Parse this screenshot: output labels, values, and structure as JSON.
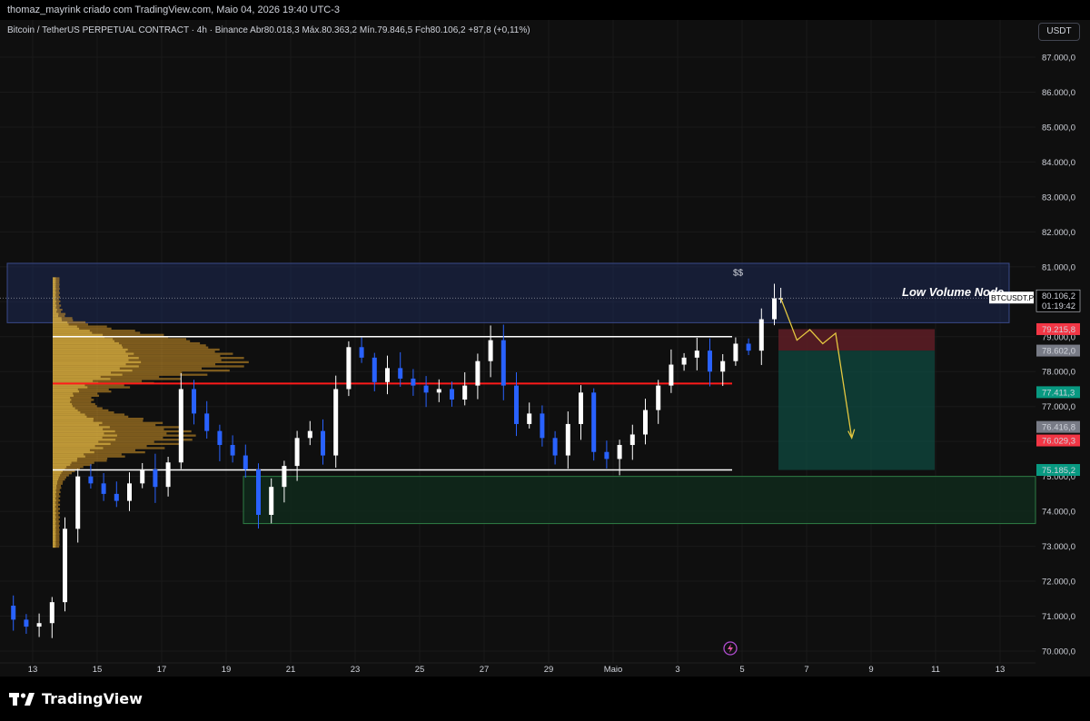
{
  "header": {
    "title": "thomaz_mayrink criado com TradingView.com, Maio 04, 2026 19:40 UTC-3"
  },
  "symbol": {
    "name": "Bitcoin / TetherUS PERPETUAL CONTRACT · 4h · Binance",
    "open_label": "Abr",
    "open_value": "80.018,3",
    "high_label": "Máx.",
    "high_value": "80.363,2",
    "low_label": "Mín.",
    "low_value": "79.846,5",
    "close_label": "Fch",
    "close_value": "80.106,2",
    "change": "+87,8 (+0,11%)"
  },
  "currency_button": "USDT",
  "annotations": {
    "low_volume_node": "Low Volume Node",
    "dollar_marks": "$$"
  },
  "price_axis": {
    "ticks": [
      "87.000,0",
      "86.000,0",
      "85.000,0",
      "84.000,0",
      "83.000,0",
      "82.000,0",
      "81.000,0",
      "80.000,0",
      "79.000,0",
      "78.000,0",
      "77.000,0",
      "76.000,0",
      "75.000,0",
      "74.000,0",
      "73.000,0",
      "72.000,0",
      "71.000,0",
      "70.000,0"
    ],
    "current_symbol": "BTCUSDT.P",
    "current_price": "80.106,2",
    "countdown": "01:19:42",
    "labels": [
      {
        "text": "79.215,8",
        "color": "#f23645"
      },
      {
        "text": "78.602,0",
        "color": "#787b86"
      },
      {
        "text": "77.411,3",
        "color": "#089981"
      },
      {
        "text": "76.416,8",
        "color": "#787b86"
      },
      {
        "text": "76.029,3",
        "color": "#f23645"
      },
      {
        "text": "75.185,2",
        "color": "#089981"
      }
    ]
  },
  "time_axis": {
    "labels": [
      "13",
      "15",
      "17",
      "19",
      "21",
      "23",
      "25",
      "27",
      "29",
      "Maio",
      "3",
      "5",
      "7",
      "9",
      "11",
      "13"
    ]
  },
  "colors": {
    "background": "#0f0f0f",
    "up_candle": "#ffffff",
    "down_candle": "#2962ff",
    "resistance_line": "#ff1a1a",
    "zone_blue": "#1e2a55",
    "zone_green": "#0f2a1c",
    "target_green": "#0f4a40",
    "stop_red": "#5a1d25",
    "forecast": "#e5c840"
  },
  "footer": {
    "brand": "TradingView"
  }
}
